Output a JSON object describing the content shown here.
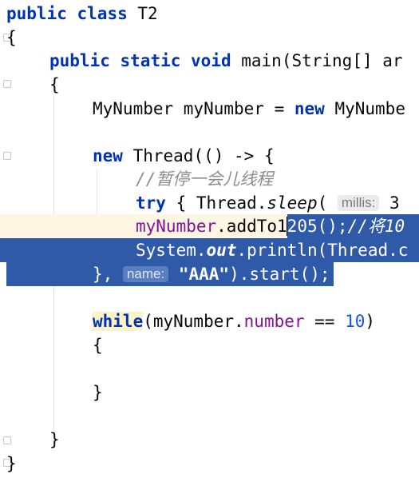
{
  "editor": {
    "lines": {
      "l1": {
        "kw1": "public",
        "kw2": "class",
        "name": " T2"
      },
      "l2": {
        "brace": "{"
      },
      "l3": {
        "kw1": "public",
        "kw2": "static",
        "kw3": "void",
        "rest": " main(String[] ar"
      },
      "l4": {
        "brace": "{"
      },
      "l5": {
        "pre": "MyNumber myNumber = ",
        "kw": "new",
        "post": " MyNumbe"
      },
      "l7": {
        "kw": "new",
        "rest": " Thread(() -> {"
      },
      "l8": {
        "comment": "//暂停一会儿线程"
      },
      "l9": {
        "kw": "try",
        "mid": " { Thread.",
        "method": "sleep",
        "paren": "( ",
        "hint": "millis:",
        "tail": " 3"
      },
      "l10": {
        "field": "myNumber",
        "pre": ".addTo1",
        "post": "205();",
        "comment": "//将10"
      },
      "l11": {
        "pre": "System.",
        "out": "out",
        "post": ".println(Thread.c"
      },
      "l12": {
        "pre": "}, ",
        "hint": "name:",
        "str": "\"AAA\"",
        "post": ").start();"
      },
      "l14": {
        "kw": "while",
        "pre": "(myNumber.",
        "field": "number",
        "op": " == ",
        "num": "10",
        "post": ")"
      },
      "l15": {
        "brace": "{"
      },
      "l17": {
        "brace": "}"
      },
      "l19": {
        "brace": "}"
      },
      "l20": {
        "brace": "}"
      }
    }
  }
}
